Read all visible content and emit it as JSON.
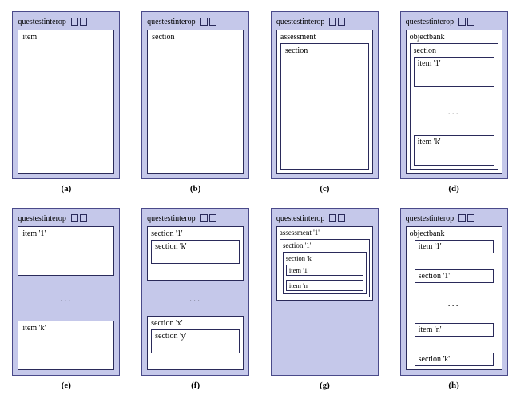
{
  "common": {
    "root": "questestinterop",
    "ellipsis": "..."
  },
  "panels": {
    "a": {
      "caption": "(a)",
      "child": "item"
    },
    "b": {
      "caption": "(b)",
      "child": "section"
    },
    "c": {
      "caption": "(c)",
      "outer": "assessment",
      "inner": "section"
    },
    "d": {
      "caption": "(d)",
      "outer": "objectbank",
      "mid": "section",
      "first": "item '1'",
      "last": "item 'k'"
    },
    "e": {
      "caption": "(e)",
      "first": "item '1'",
      "last": "item 'k'"
    },
    "f": {
      "caption": "(f)",
      "sec1": "section '1'",
      "sec1_inner": "section 'k'",
      "secx": "section 'x'",
      "secx_inner": "section 'y'"
    },
    "g": {
      "caption": "(g)",
      "assess": "assessment '1'",
      "sec1": "section '1'",
      "seck": "section 'k'",
      "item1": "item '1'",
      "itemn": "item 'n'"
    },
    "h": {
      "caption": "(h)",
      "bank": "objectbank",
      "item1": "item '1'",
      "sec1": "section '1'",
      "itemn": "item 'n'",
      "seck": "section 'k'"
    }
  }
}
